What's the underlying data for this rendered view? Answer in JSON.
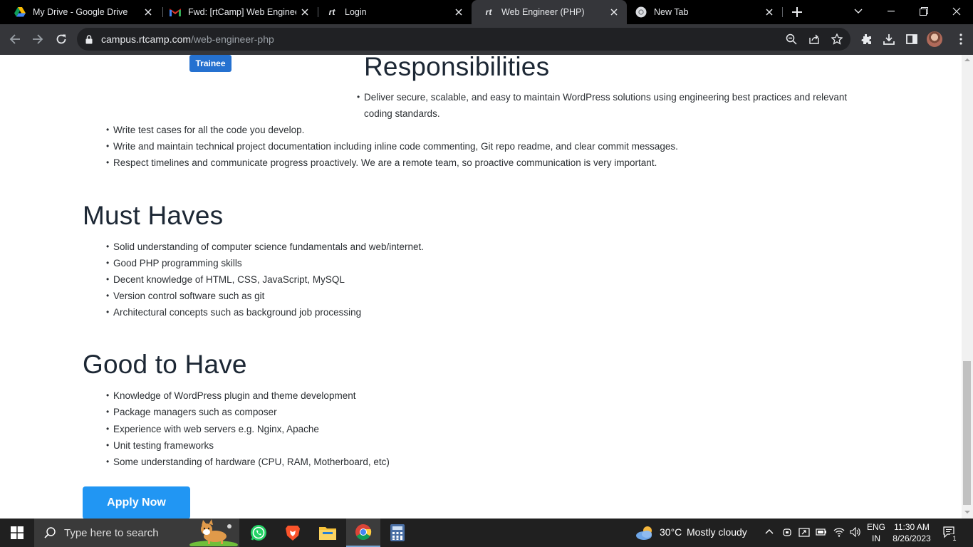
{
  "browser": {
    "tabs": [
      {
        "title": "My Drive - Google Drive",
        "icon": "google-drive-icon"
      },
      {
        "title": "Fwd: [rtCamp] Web Engineer",
        "icon": "gmail-icon"
      },
      {
        "title": "Login",
        "icon": "rtcamp-icon"
      },
      {
        "title": "Web Engineer (PHP)",
        "icon": "rtcamp-icon",
        "active": true
      },
      {
        "title": "New Tab",
        "icon": "chrome-icon"
      }
    ],
    "url_host": "campus.rtcamp.com",
    "url_path": "/web-engineer-php"
  },
  "page": {
    "badge": "Trainee",
    "responsibilities": {
      "heading": "Responsibilities",
      "items": [
        "Deliver secure, scalable, and easy to maintain WordPress solutions using engineering best practices and relevant",
        "coding standards.",
        "Write test cases for all the code you develop.",
        "Write and maintain technical project documentation including inline code commenting, Git repo readme, and clear commit messages.",
        "Respect timelines and communicate progress proactively. We are a remote team, so proactive communication is very important."
      ]
    },
    "must_haves": {
      "heading": "Must Haves",
      "items": [
        "Solid understanding of computer science fundamentals and web/internet.",
        "Good PHP programming skills",
        "Decent knowledge of HTML, CSS, JavaScript, MySQL",
        "Version control software such as git",
        "Architectural concepts such as background job processing"
      ]
    },
    "good_to_have": {
      "heading": "Good to Have",
      "items": [
        "Knowledge of WordPress plugin and theme development",
        "Package managers such as composer",
        "Experience with web servers e.g. Nginx, Apache",
        "Unit testing frameworks",
        "Some understanding of hardware (CPU, RAM, Motherboard, etc)"
      ]
    },
    "apply_label": "Apply Now"
  },
  "taskbar": {
    "search_placeholder": "Type here to search",
    "weather_temp": "30°C",
    "weather_desc": "Mostly cloudy",
    "lang": "ENG",
    "region": "IN",
    "time": "11:30 AM",
    "date": "8/26/2023",
    "notification_count": "1"
  }
}
